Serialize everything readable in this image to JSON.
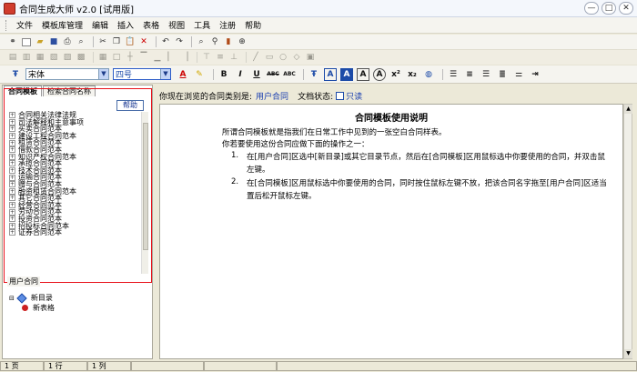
{
  "window": {
    "title": "合同生成大师 v2.0 [试用版]",
    "minimize": "—",
    "maximize": "□",
    "close": "✕"
  },
  "menu": [
    "文件",
    "模板库管理",
    "编辑",
    "插入",
    "表格",
    "视图",
    "工具",
    "注册",
    "帮助"
  ],
  "format": {
    "font": "宋体",
    "size": "四号"
  },
  "left_panel": {
    "tabs": [
      "合同模板",
      "检索合同名称"
    ],
    "help_button": "帮助",
    "tree_items": [
      "合同相关法律法规",
      "司法解释和主意事项",
      "买卖合同范本",
      "建设工程合同范本",
      "租赁合同范本",
      "借款合同范本",
      "知识产权合同范本",
      "承揽合同范本",
      "技术合同范本",
      "运输合同范本",
      "赠与合同范本",
      "融资租赁合同范本",
      "其它合同范本",
      "经营合同范本",
      "劳动合同范本",
      "投资合同范本",
      "招投标合同范本",
      "证券合同范本"
    ],
    "user_contracts_tab": "用户合同",
    "user_tree": {
      "root": "新目录",
      "child": "新表格"
    }
  },
  "doc_header": {
    "prefix": "你现在浏览的合同类别是:",
    "category": "用户合同",
    "status_label": "文档状态:",
    "readonly_label": "只读"
  },
  "document": {
    "title": "合同模板使用说明",
    "intro": "所谓合同模板就是指我们在日常工作中见到的一张空白合同样表。",
    "lead": "你若要使用这份合同应做下面的操作之一：",
    "steps": [
      {
        "num": "1.",
        "line1": "在[用户合同]区选中[新目录]或其它目录节点，然后在[合同模板]区用鼠标选中你要使用的合同，并双击鼠",
        "line2": "左键。"
      },
      {
        "num": "2.",
        "line1": "在[合同模板]区用鼠标选中你要使用的合同，同时按住鼠标左键不放，把该合同名字拖至[用户合同]区适当",
        "line2": "置后松开鼠标左键。"
      }
    ]
  },
  "status": [
    "1 页",
    "1 行",
    "1 列"
  ]
}
